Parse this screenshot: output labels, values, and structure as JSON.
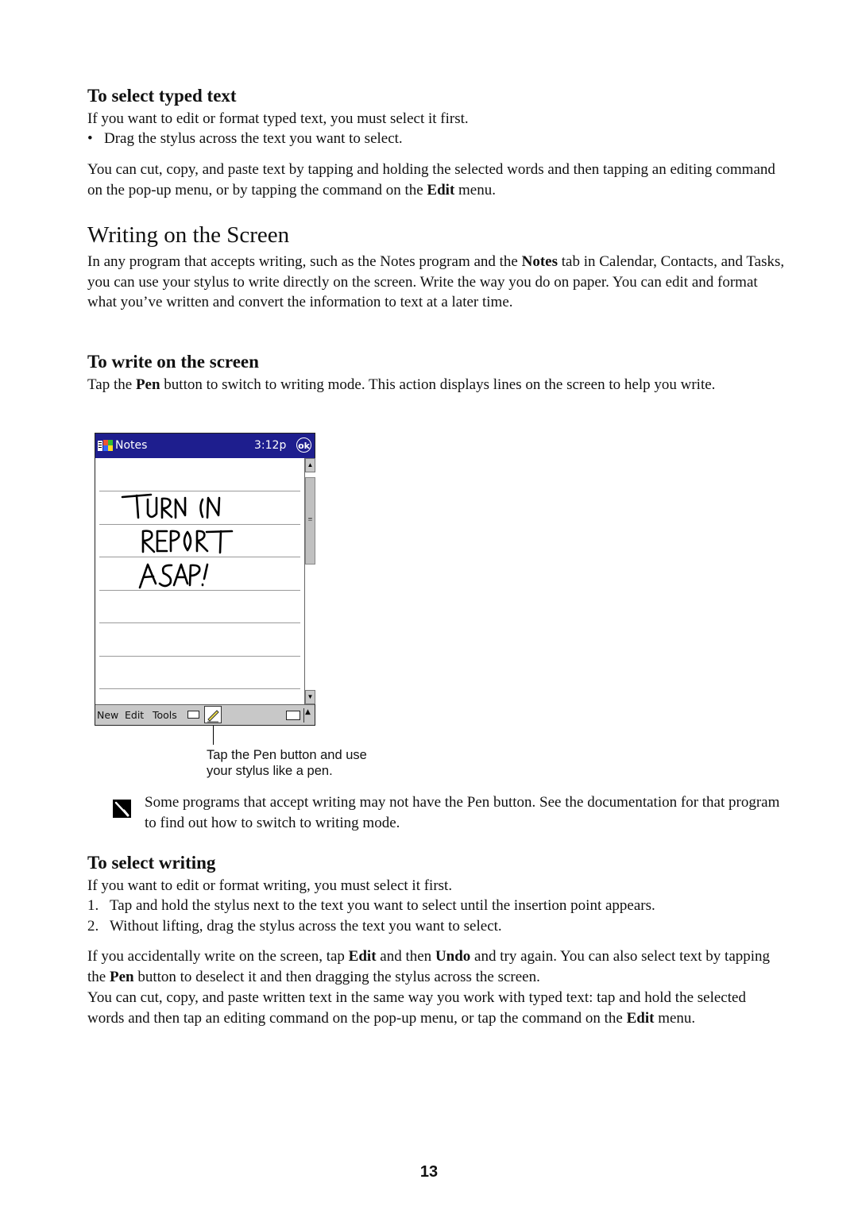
{
  "section_select_typed": {
    "heading": "To select typed text",
    "intro": "If you want to edit or format typed text, you must select it first.",
    "bullets": [
      "Drag the stylus across the text you want to select."
    ],
    "para_pre": "You can cut, copy, and paste text by tapping and holding the selected words and then tapping an editing command on the pop-up menu, or by tapping the command on the ",
    "para_bold": "Edit",
    "para_post": " menu."
  },
  "section_writing": {
    "heading": "Writing on the Screen",
    "para_pre": "In any program that accepts writing, such as the Notes program and the ",
    "para_bold": "Notes",
    "para_post": " tab in Calendar, Contacts, and Tasks, you can use your stylus to write directly on the screen. Write the way you do on paper. You can edit and format what you’ve written and convert the information to text at a later time."
  },
  "section_write_on_screen": {
    "heading": "To write on the screen",
    "para_pre": "Tap the ",
    "para_bold": "Pen",
    "para_post": " button to switch to writing mode. This action displays lines on the screen to help you write."
  },
  "device": {
    "app_name": "Notes",
    "time": "3:12p",
    "ok_label": "ok",
    "handwriting_lines": [
      "TURN IN",
      "REPORT",
      "ASAP!"
    ],
    "menu": [
      "New",
      "Edit",
      "Tools"
    ],
    "icons": [
      "start-logo-icon",
      "ok-icon",
      "keyboard-toggle-icon",
      "pen-icon",
      "input-panel-icon",
      "scroll-up-icon",
      "scroll-down-icon"
    ],
    "colors": {
      "titlebar": "#1e1e8e",
      "menubar": "#c8c8c8"
    }
  },
  "callout": {
    "line1": "Tap the Pen button and use",
    "line2": "your stylus like a pen."
  },
  "note": {
    "text": "Some programs that accept writing may not have the Pen button. See the documentation for that program to find out how to switch to writing mode."
  },
  "section_select_writing": {
    "heading": "To select writing",
    "intro": "If you want to edit or format writing, you must select it first.",
    "steps": [
      {
        "num": "1.",
        "text": "Tap and hold the stylus next to the text you want to select until the insertion point appears."
      },
      {
        "num": "2.",
        "text": "Without lifting, drag the stylus across the text you want to select."
      }
    ],
    "para1": {
      "t1": "If you accidentally write on the screen, tap ",
      "b1": "Edit",
      "t2": " and then ",
      "b2": "Undo",
      "t3": " and try again. You can also select text by tapping the ",
      "b3": "Pen",
      "t4": " button to deselect it and then dragging the stylus across the screen."
    },
    "para2": {
      "t1": "You can cut, copy, and paste written text in the same way you work with typed text: tap and hold the selected words and then tap an editing command on the pop-up menu, or tap the command on the ",
      "b1": "Edit",
      "t2": " menu."
    }
  },
  "page_number": "13"
}
